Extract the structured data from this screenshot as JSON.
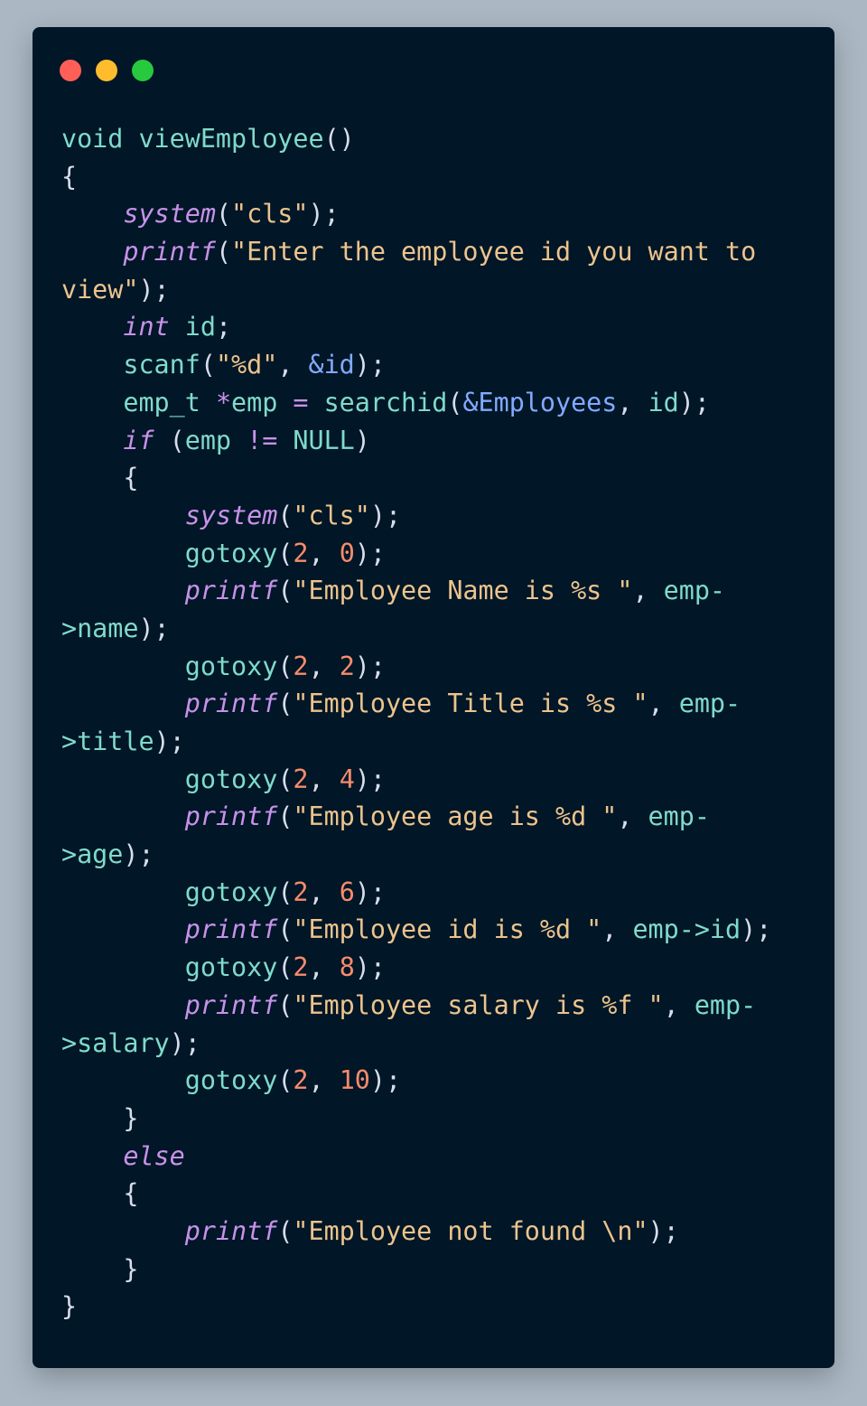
{
  "window": {
    "dots": [
      {
        "name": "close",
        "color": "#ff5f56"
      },
      {
        "name": "minimize",
        "color": "#ffbd2e"
      },
      {
        "name": "maximize",
        "color": "#27c93f"
      }
    ]
  },
  "code": {
    "language": "C",
    "colors": {
      "background": "#011627",
      "keyword": "#c792ea",
      "identifier": "#7fdbca",
      "string": "#ecc48d",
      "number": "#f78c6c",
      "reference": "#82aaff",
      "punctuation": "#d6deeb"
    },
    "lines": [
      [
        [
          "id",
          "void viewEmployee"
        ],
        [
          "pun",
          "()"
        ]
      ],
      [
        [
          "pun",
          "{"
        ]
      ],
      [
        [
          "pun",
          "    "
        ],
        [
          "fn",
          "system"
        ],
        [
          "pun",
          "("
        ],
        [
          "str",
          "\"cls\""
        ],
        [
          "pun",
          ");"
        ]
      ],
      [
        [
          "pun",
          "    "
        ],
        [
          "fn",
          "printf"
        ],
        [
          "pun",
          "("
        ],
        [
          "str",
          "\"Enter the employee id you want to"
        ]
      ],
      [
        [
          "str",
          "view\""
        ],
        [
          "pun",
          ");"
        ]
      ],
      [
        [
          "pun",
          "    "
        ],
        [
          "kw",
          "int"
        ],
        [
          "id",
          " id"
        ],
        [
          "pun",
          ";"
        ]
      ],
      [
        [
          "pun",
          "    "
        ],
        [
          "id",
          "scanf"
        ],
        [
          "pun",
          "("
        ],
        [
          "str",
          "\"%d\""
        ],
        [
          "pun",
          ", "
        ],
        [
          "amp",
          "&id"
        ],
        [
          "pun",
          ");"
        ]
      ],
      [
        [
          "pun",
          "    "
        ],
        [
          "id",
          "emp_t "
        ],
        [
          "op",
          "*"
        ],
        [
          "id",
          "emp "
        ],
        [
          "op",
          "="
        ],
        [
          "id",
          " searchid"
        ],
        [
          "pun",
          "("
        ],
        [
          "amp",
          "&Employees"
        ],
        [
          "pun",
          ", "
        ],
        [
          "id",
          "id"
        ],
        [
          "pun",
          ");"
        ]
      ],
      [
        [
          "pun",
          "    "
        ],
        [
          "kw",
          "if"
        ],
        [
          "pun",
          " ("
        ],
        [
          "id",
          "emp "
        ],
        [
          "op",
          "!="
        ],
        [
          "id",
          " NULL"
        ],
        [
          "pun",
          ")"
        ]
      ],
      [
        [
          "pun",
          "    {"
        ]
      ],
      [
        [
          "pun",
          "        "
        ],
        [
          "fn",
          "system"
        ],
        [
          "pun",
          "("
        ],
        [
          "str",
          "\"cls\""
        ],
        [
          "pun",
          ");"
        ]
      ],
      [
        [
          "pun",
          "        "
        ],
        [
          "id",
          "gotoxy"
        ],
        [
          "pun",
          "("
        ],
        [
          "num",
          "2"
        ],
        [
          "pun",
          ", "
        ],
        [
          "num",
          "0"
        ],
        [
          "pun",
          ");"
        ]
      ],
      [
        [
          "pun",
          "        "
        ],
        [
          "fn",
          "printf"
        ],
        [
          "pun",
          "("
        ],
        [
          "str",
          "\"Employee Name is %s \""
        ],
        [
          "pun",
          ", "
        ],
        [
          "id",
          "emp-"
        ]
      ],
      [
        [
          "id",
          ">name"
        ],
        [
          "pun",
          ");"
        ]
      ],
      [
        [
          "pun",
          "        "
        ],
        [
          "id",
          "gotoxy"
        ],
        [
          "pun",
          "("
        ],
        [
          "num",
          "2"
        ],
        [
          "pun",
          ", "
        ],
        [
          "num",
          "2"
        ],
        [
          "pun",
          ");"
        ]
      ],
      [
        [
          "pun",
          "        "
        ],
        [
          "fn",
          "printf"
        ],
        [
          "pun",
          "("
        ],
        [
          "str",
          "\"Employee Title is %s \""
        ],
        [
          "pun",
          ", "
        ],
        [
          "id",
          "emp-"
        ]
      ],
      [
        [
          "id",
          ">title"
        ],
        [
          "pun",
          ");"
        ]
      ],
      [
        [
          "pun",
          "        "
        ],
        [
          "id",
          "gotoxy"
        ],
        [
          "pun",
          "("
        ],
        [
          "num",
          "2"
        ],
        [
          "pun",
          ", "
        ],
        [
          "num",
          "4"
        ],
        [
          "pun",
          ");"
        ]
      ],
      [
        [
          "pun",
          "        "
        ],
        [
          "fn",
          "printf"
        ],
        [
          "pun",
          "("
        ],
        [
          "str",
          "\"Employee age is %d \""
        ],
        [
          "pun",
          ", "
        ],
        [
          "id",
          "emp-"
        ]
      ],
      [
        [
          "id",
          ">age"
        ],
        [
          "pun",
          ");"
        ]
      ],
      [
        [
          "pun",
          "        "
        ],
        [
          "id",
          "gotoxy"
        ],
        [
          "pun",
          "("
        ],
        [
          "num",
          "2"
        ],
        [
          "pun",
          ", "
        ],
        [
          "num",
          "6"
        ],
        [
          "pun",
          ");"
        ]
      ],
      [
        [
          "pun",
          "        "
        ],
        [
          "fn",
          "printf"
        ],
        [
          "pun",
          "("
        ],
        [
          "str",
          "\"Employee id is %d \""
        ],
        [
          "pun",
          ", "
        ],
        [
          "id",
          "emp->id"
        ],
        [
          "pun",
          ");"
        ]
      ],
      [
        [
          "pun",
          "        "
        ],
        [
          "id",
          "gotoxy"
        ],
        [
          "pun",
          "("
        ],
        [
          "num",
          "2"
        ],
        [
          "pun",
          ", "
        ],
        [
          "num",
          "8"
        ],
        [
          "pun",
          ");"
        ]
      ],
      [
        [
          "pun",
          "        "
        ],
        [
          "fn",
          "printf"
        ],
        [
          "pun",
          "("
        ],
        [
          "str",
          "\"Employee salary is %f \""
        ],
        [
          "pun",
          ", "
        ],
        [
          "id",
          "emp-"
        ]
      ],
      [
        [
          "id",
          ">salary"
        ],
        [
          "pun",
          ");"
        ]
      ],
      [
        [
          "pun",
          "        "
        ],
        [
          "id",
          "gotoxy"
        ],
        [
          "pun",
          "("
        ],
        [
          "num",
          "2"
        ],
        [
          "pun",
          ", "
        ],
        [
          "num",
          "10"
        ],
        [
          "pun",
          ");"
        ]
      ],
      [
        [
          "pun",
          "    }"
        ]
      ],
      [
        [
          "pun",
          "    "
        ],
        [
          "kw",
          "else"
        ]
      ],
      [
        [
          "pun",
          "    {"
        ]
      ],
      [
        [
          "pun",
          "        "
        ],
        [
          "fn",
          "printf"
        ],
        [
          "pun",
          "("
        ],
        [
          "str",
          "\"Employee not found \\n\""
        ],
        [
          "pun",
          ");"
        ]
      ],
      [
        [
          "pun",
          "    }"
        ]
      ],
      [
        [
          "pun",
          "}"
        ]
      ]
    ]
  }
}
